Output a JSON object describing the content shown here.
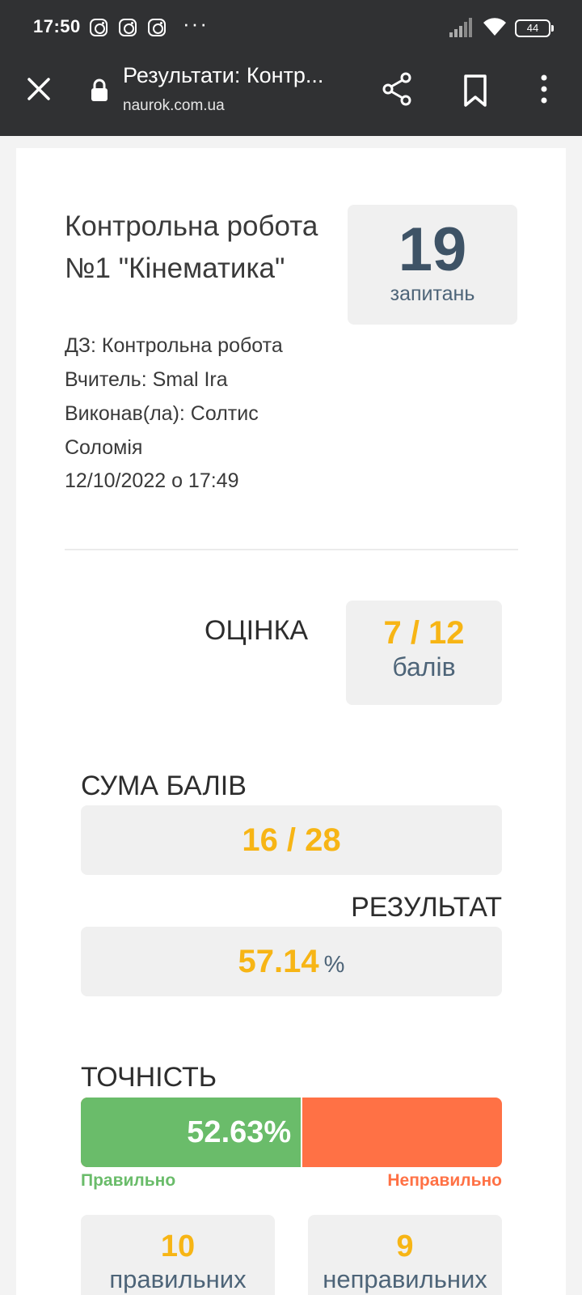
{
  "status_bar": {
    "time": "17:50",
    "more": "···",
    "battery": "44"
  },
  "browser": {
    "page_title": "Результати: Контр...",
    "host": "naurok.com.ua"
  },
  "test": {
    "title": "Контрольна робота №1 \"Кінематика\"",
    "hw": "ДЗ: Контрольна робота",
    "teacher": "Вчитель: Smal Ira",
    "student_line1": "Виконав(ла): Солтис",
    "student_line2": "Соломія",
    "date": "12/10/2022 о 17:49"
  },
  "questions": {
    "count": "19",
    "label": "запитань"
  },
  "grade": {
    "label": "ОЦІНКА",
    "value": "7 / 12",
    "unit": "балів"
  },
  "sum": {
    "label": "СУМА БАЛІВ",
    "value": "16 / 28"
  },
  "result": {
    "label": "РЕЗУЛЬТАТ",
    "value": "57.14",
    "unit": "%"
  },
  "accuracy": {
    "label": "ТОЧНІСТЬ",
    "percent_text": "52.63%",
    "fraction": 0.5263,
    "correct_label": "Правильно",
    "wrong_label": "Неправильно"
  },
  "counts": {
    "correct": {
      "value": "10",
      "label": "правильних"
    },
    "wrong": {
      "value": "9",
      "label": "неправильних"
    }
  },
  "colors": {
    "accent": "#f7b515",
    "correct": "#6abc6a",
    "wrong": "#ff7145",
    "header": "#303133"
  }
}
